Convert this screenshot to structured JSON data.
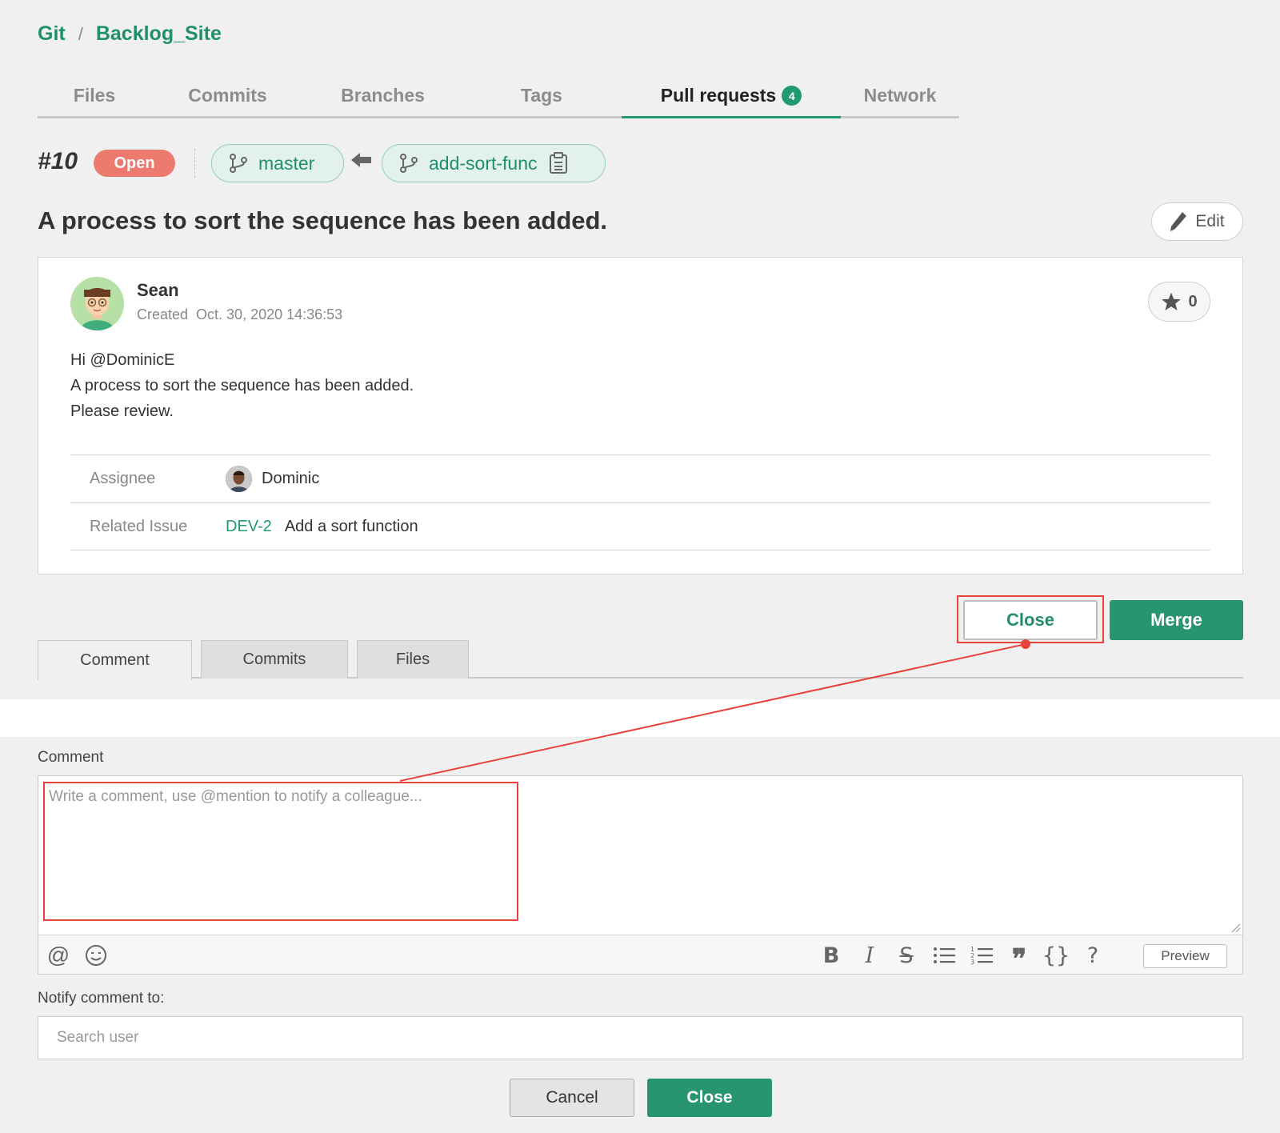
{
  "breadcrumb": {
    "root": "Git",
    "separator": "/",
    "repo": "Backlog_Site"
  },
  "tabs": [
    {
      "label": "Files"
    },
    {
      "label": "Commits"
    },
    {
      "label": "Branches"
    },
    {
      "label": "Tags"
    },
    {
      "label": "Pull requests",
      "badge": "4",
      "active": true
    },
    {
      "label": "Network"
    }
  ],
  "pull_request": {
    "number": "#10",
    "status": "Open",
    "base_branch": "master",
    "head_branch": "add-sort-func",
    "title": "A process to sort the sequence has been added.",
    "edit_label": "Edit"
  },
  "description": {
    "author": "Sean",
    "created_label": "Created",
    "created_at": "Oct. 30, 2020 14:36:53",
    "star_count": "0",
    "lines": [
      "Hi @DominicE",
      "A process to sort the sequence has been added.",
      "Please review."
    ],
    "assignee_label": "Assignee",
    "assignee": "Dominic",
    "related_issue_label": "Related Issue",
    "related_issue_key": "DEV-2",
    "related_issue_title": "Add a sort function"
  },
  "actions": {
    "close_label": "Close",
    "merge_label": "Merge"
  },
  "sub_tabs": [
    {
      "label": "Comment",
      "active": true
    },
    {
      "label": "Commits"
    },
    {
      "label": "Files"
    }
  ],
  "comment_form": {
    "label": "Comment",
    "placeholder": "Write a comment, use @mention to notify a colleague...",
    "toolbar": {
      "mention": "@",
      "bold": "B",
      "italic": "I",
      "strike": "S",
      "quote": "❞",
      "code": "{}",
      "help": "?",
      "preview_label": "Preview"
    },
    "notify_label": "Notify comment to:",
    "search_placeholder": "Search user",
    "cancel_label": "Cancel",
    "submit_label": "Close"
  },
  "colors": {
    "accent": "#27956d",
    "link": "#1f8f6c",
    "status_open": "#ec7a6e",
    "highlight": "#e8423b"
  }
}
